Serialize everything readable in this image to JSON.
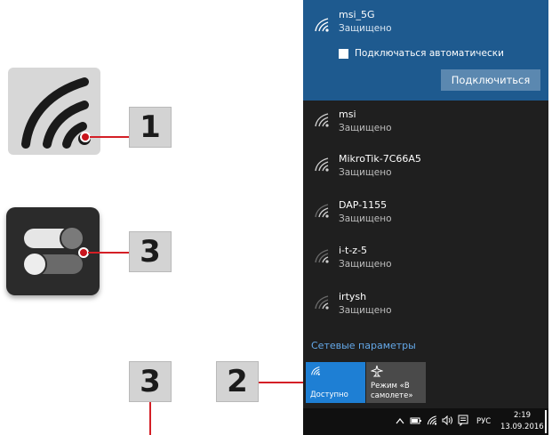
{
  "callouts": {
    "wifi_badge": "1",
    "toggle_badge": "3",
    "bottom_badge_left": "3",
    "bottom_badge_right": "2"
  },
  "flyout": {
    "active_network": {
      "name": "msi_5G",
      "status": "Защищено",
      "auto_connect_label": "Подключаться автоматически",
      "connect_button": "Подключиться"
    },
    "networks": [
      {
        "name": "msi",
        "status": "Защищено"
      },
      {
        "name": "MikroTik-7C66A5",
        "status": "Защищено"
      },
      {
        "name": "DAP-1155",
        "status": "Защищено"
      },
      {
        "name": "i-t-z-5",
        "status": "Защищено"
      },
      {
        "name": "irtysh",
        "status": "Защищено"
      }
    ],
    "settings_link": "Сетевые параметры",
    "quick_actions": {
      "wifi_label": "Доступно",
      "airplane_label_line1": "Режим «В",
      "airplane_label_line2": "самолете»"
    },
    "taskbar": {
      "language": "РУС",
      "time": "2:19",
      "date": "13.09.2016"
    }
  },
  "colors": {
    "accent_red": "#d41f26",
    "flyout_bg": "#1f1f1f",
    "active_bg": "#1e5a8f",
    "link_blue": "#64a8e8",
    "quick_wifi_bg": "#1e7fd4"
  },
  "icons": {
    "wifi": "wifi-icon",
    "toggle": "toggle-switches-icon",
    "airplane": "airplane-icon",
    "chevron_up": "chevron-up-icon",
    "battery": "battery-icon",
    "volume": "volume-icon",
    "notifications": "notifications-icon"
  }
}
